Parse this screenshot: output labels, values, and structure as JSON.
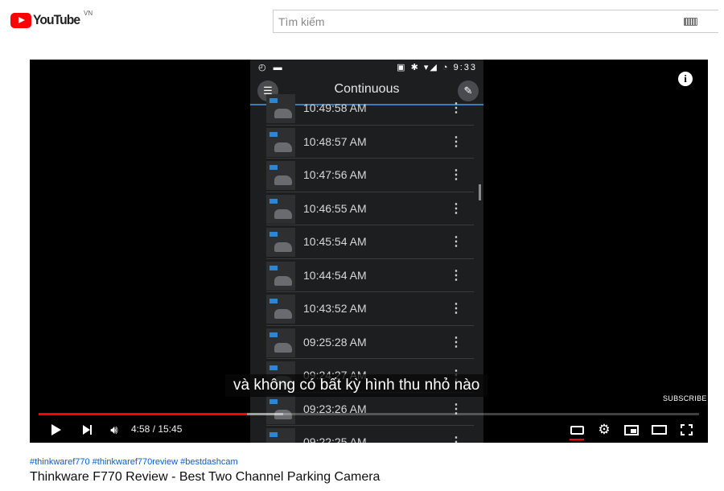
{
  "header": {
    "logo_text": "YouTube",
    "country_code": "VN",
    "search_placeholder": "Tìm kiếm",
    "icons": {
      "logo": "youtube-logo-icon",
      "keyboard": "keyboard-icon"
    }
  },
  "player": {
    "phone": {
      "status_left": "◴ ▬",
      "status_right": "▣ ✱ ▾◢ ◔ 9:33",
      "app_title": "Continuous",
      "recordings": [
        {
          "time": "10:49:58 AM"
        },
        {
          "time": "10:48:57 AM"
        },
        {
          "time": "10:47:56 AM"
        },
        {
          "time": "10:46:55 AM"
        },
        {
          "time": "10:45:54 AM"
        },
        {
          "time": "10:44:54 AM"
        },
        {
          "time": "10:43:52 AM"
        },
        {
          "time": "09:25:28 AM"
        },
        {
          "time": "09:24:27 AM"
        },
        {
          "time": "09:23:26 AM"
        },
        {
          "time": "09:22:25 AM"
        }
      ]
    },
    "caption": "và không có bất kỳ hình thu nhỏ nào",
    "subscribe_label": "SUBSCRIBE",
    "time_current": "4:58",
    "time_total": "15:45",
    "time_display": "4:58 / 15:45",
    "progress": {
      "played_fraction": 0.316,
      "loaded_fraction": 0.37
    },
    "colors": {
      "played": "#ff0000",
      "accent_blue": "#2b86d6"
    },
    "icons": {
      "info": "info-icon",
      "play": "play-icon",
      "next": "next-icon",
      "volume": "volume-icon",
      "subtitles": "subtitles-icon",
      "settings": "settings-icon",
      "miniplayer": "miniplayer-icon",
      "theater": "theater-icon",
      "fullscreen": "fullscreen-icon"
    }
  },
  "video": {
    "hashtags": "#thinkwaref770 #thinkwaref770review #bestdashcam",
    "title": "Thinkware F770 Review - Best Two Channel Parking Camera"
  }
}
